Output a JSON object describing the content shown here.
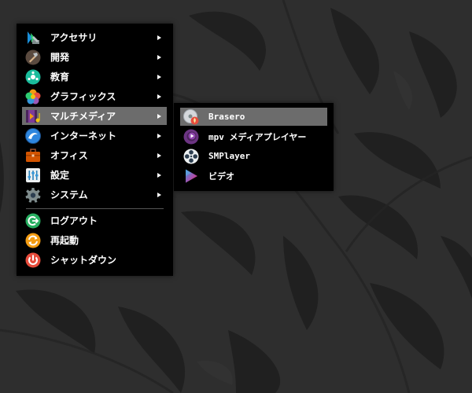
{
  "desktop": {
    "wallpaper_color": "#2d2d2d",
    "pattern_color": "#1e1e1e"
  },
  "main_menu": {
    "items": [
      {
        "label": "アクセサリ",
        "icon": "accessories-icon",
        "submenu": true
      },
      {
        "label": "開発",
        "icon": "development-icon",
        "submenu": true
      },
      {
        "label": "教育",
        "icon": "education-icon",
        "submenu": true
      },
      {
        "label": "グラフィックス",
        "icon": "graphics-icon",
        "submenu": true
      },
      {
        "label": "マルチメディア",
        "icon": "multimedia-icon",
        "submenu": true,
        "selected": true
      },
      {
        "label": "インターネット",
        "icon": "internet-icon",
        "submenu": true
      },
      {
        "label": "オフィス",
        "icon": "office-icon",
        "submenu": true
      },
      {
        "label": "設定",
        "icon": "settings-icon",
        "submenu": true
      },
      {
        "label": "システム",
        "icon": "system-icon",
        "submenu": true
      }
    ],
    "actions": [
      {
        "label": "ログアウト",
        "icon": "logout-icon"
      },
      {
        "label": "再起動",
        "icon": "restart-icon"
      },
      {
        "label": "シャットダウン",
        "icon": "shutdown-icon"
      }
    ]
  },
  "submenu": {
    "items": [
      {
        "label": "Brasero",
        "icon": "brasero-icon",
        "selected": true
      },
      {
        "label": "mpv メディアプレイヤー",
        "icon": "mpv-icon"
      },
      {
        "label": "SMPlayer",
        "icon": "smplayer-icon"
      },
      {
        "label": "ビデオ",
        "icon": "video-icon"
      }
    ]
  },
  "colors": {
    "menu_background": "#000000",
    "selection": "#6c6c6c",
    "text": "#ffffff"
  }
}
